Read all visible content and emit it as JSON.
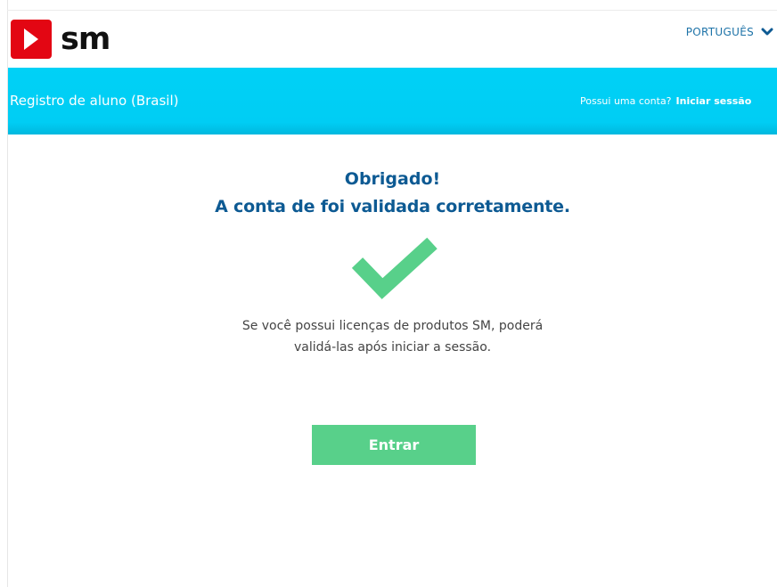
{
  "brand": {
    "logo_text": "sm",
    "logo_color": "#e30613"
  },
  "header": {
    "language_label": "PORTUGUÊS",
    "language_icon": "chevron-down-icon"
  },
  "bar": {
    "title": "Registro de aluno (Brasil)",
    "account_question": "Possui uma conta?",
    "login_link": "Iniciar sessão",
    "color": "#00cdf4"
  },
  "content": {
    "title_line_1": "Obrigado!",
    "title_line_2": "A conta de foi validada corretamente.",
    "title_color": "#0d5a93",
    "success_icon": "checkmark-icon",
    "success_color": "#58d08a",
    "message_line_1": "Se você possui licenças de produtos SM, poderá",
    "message_line_2": "validá-las após iniciar a sessão.",
    "enter_button_label": "Entrar"
  }
}
